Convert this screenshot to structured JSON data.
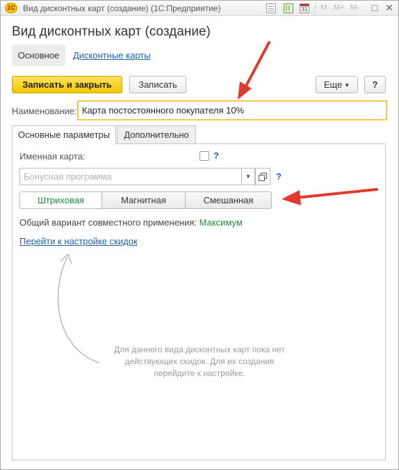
{
  "window": {
    "logo_text": "1С",
    "title": "Вид дисконтных карт (создание)",
    "app_name": "(1С:Предприятие)",
    "toolbar_m": [
      "M",
      "M+",
      "M-"
    ],
    "calendar_day": "31",
    "controls": [
      "□",
      "✕"
    ]
  },
  "page": {
    "title": "Вид дисконтных карт (создание)"
  },
  "nav": {
    "main_label": "Основное",
    "link_label": "Дисконтные карты"
  },
  "commands": {
    "save_close_label": "Записать и закрыть",
    "save_label": "Записать",
    "more_label": "Еще",
    "help_label": "?"
  },
  "name_field": {
    "label": "Наименование:",
    "value": "Карта постостоянного покупателя 10%"
  },
  "tabs": [
    {
      "label": "Основные параметры",
      "active": true
    },
    {
      "label": "Дополнительно",
      "active": false
    }
  ],
  "main_params": {
    "named_card_label": "Именная карта:",
    "named_card_checked": false,
    "hint_label": "?",
    "bonus_placeholder": "Бонусная программа",
    "card_types": [
      "Штриховая",
      "Магнитная",
      "Смешанная"
    ],
    "selected_card_type": "Штриховая",
    "combination_label": "Общий вариант совместного применения:",
    "combination_value": "Максимум",
    "discount_settings_link": "Перейти к настройке скидок",
    "empty_message": "Для данного вида дисконтных карт пока нет действующих скидок. Для их создания перейдите к настройке."
  },
  "colors": {
    "primary_button": "#f3c600",
    "link": "#1f5faa",
    "selected_green": "#1e8a3a",
    "annotation_arrow": "#e03a2f"
  }
}
